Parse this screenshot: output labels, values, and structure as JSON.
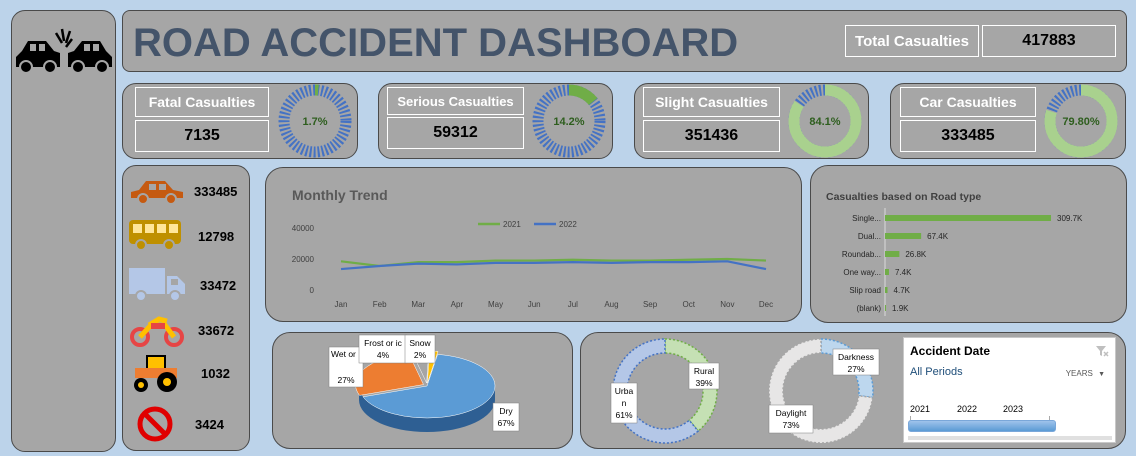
{
  "header": {
    "title": "ROAD ACCIDENT DASHBOARD",
    "total_label": "Total Casualties",
    "total_value": "417883"
  },
  "kpis": [
    {
      "label": "Fatal Casualties",
      "value": "7135",
      "pct_label": "1.7%",
      "pct": 1.7
    },
    {
      "label": "Serious Casualties",
      "value": "59312",
      "pct_label": "14.2%",
      "pct": 14.2
    },
    {
      "label": "Slight Casualties",
      "value": "351436",
      "pct_label": "84.1%",
      "pct": 84.1
    },
    {
      "label": "Car Casualties",
      "value": "333485",
      "pct_label": "79.80%",
      "pct": 79.8
    }
  ],
  "vehicles": [
    {
      "icon": "car-icon",
      "value": "333485",
      "color": "#c55a11"
    },
    {
      "icon": "bus-icon",
      "value": "12798",
      "color": "#bf9000"
    },
    {
      "icon": "truck-icon",
      "value": "33472",
      "color": "#b4c7e7"
    },
    {
      "icon": "motorcycle-icon",
      "value": "33672",
      "color": "#e64545"
    },
    {
      "icon": "tractor-icon",
      "value": "1032",
      "color": "#ed7d31"
    },
    {
      "icon": "no-entry-icon",
      "value": "3424",
      "color": "#e00000"
    }
  ],
  "colors": {
    "green": "#70ad47",
    "blue": "#4472c4",
    "orange": "#ed7d31",
    "lightblue": "#5b9bd5"
  },
  "chart_data": [
    {
      "type": "line",
      "title": "Monthly Trend",
      "categories": [
        "Jan",
        "Feb",
        "Mar",
        "Apr",
        "May",
        "Jun",
        "Jul",
        "Aug",
        "Sep",
        "Oct",
        "Nov",
        "Dec"
      ],
      "series": [
        {
          "name": "2021",
          "values": [
            18500,
            15500,
            18000,
            18000,
            19000,
            19000,
            19500,
            19000,
            19000,
            19500,
            20000,
            19000
          ]
        },
        {
          "name": "2022",
          "values": [
            13500,
            15500,
            17000,
            16500,
            17500,
            17500,
            18000,
            17500,
            18000,
            18000,
            18500,
            13500
          ]
        }
      ],
      "yticks": [
        "40000",
        "20000",
        "0"
      ],
      "ylim": [
        0,
        40000
      ],
      "legend": "top-center"
    },
    {
      "type": "bar",
      "title": "Casualties based on Road type",
      "categories": [
        "Single...",
        "Dual...",
        "Roundab...",
        "One way...",
        "Slip road",
        "(blank)"
      ],
      "values": [
        309.7,
        67.4,
        26.8,
        7.4,
        4.7,
        1.9
      ],
      "labels": [
        "309.7K",
        "67.4K",
        "26.8K",
        "7.4K",
        "4.7K",
        "1.9K"
      ]
    },
    {
      "type": "pie",
      "slices": [
        {
          "name": "Dry",
          "value": 67,
          "label_name": "Dry",
          "label_pct": "67%",
          "color": "#5b9bd5"
        },
        {
          "name": "Wet or damp",
          "value": 27,
          "label_name": "Wet or damp",
          "label_pct": "27%",
          "color": "#ed7d31"
        },
        {
          "name": "Frost or ice",
          "value": 4,
          "label_name": "Frost or ic",
          "label_pct": "4%",
          "color": "#a5a5a5"
        },
        {
          "name": "Snow",
          "value": 2,
          "label_name": "Snow",
          "label_pct": "2%",
          "color": "#ffc000"
        }
      ]
    },
    {
      "type": "pie",
      "slices": [
        {
          "name": "Rural",
          "value": 39,
          "label_name": "Rural",
          "label_pct": "39%"
        },
        {
          "name": "Urban",
          "value": 61,
          "label_name": "Urba n",
          "label_pct": "61%"
        }
      ]
    },
    {
      "type": "pie",
      "slices": [
        {
          "name": "Darkness",
          "value": 27,
          "label_name": "Darkness",
          "label_pct": "27%"
        },
        {
          "name": "Daylight",
          "value": 73,
          "label_name": "Daylight",
          "label_pct": "73%"
        }
      ]
    }
  ],
  "slicer": {
    "title": "Accident Date",
    "selection": "All Periods",
    "period": "YEARS",
    "years": [
      "2021",
      "2022",
      "2023"
    ]
  }
}
